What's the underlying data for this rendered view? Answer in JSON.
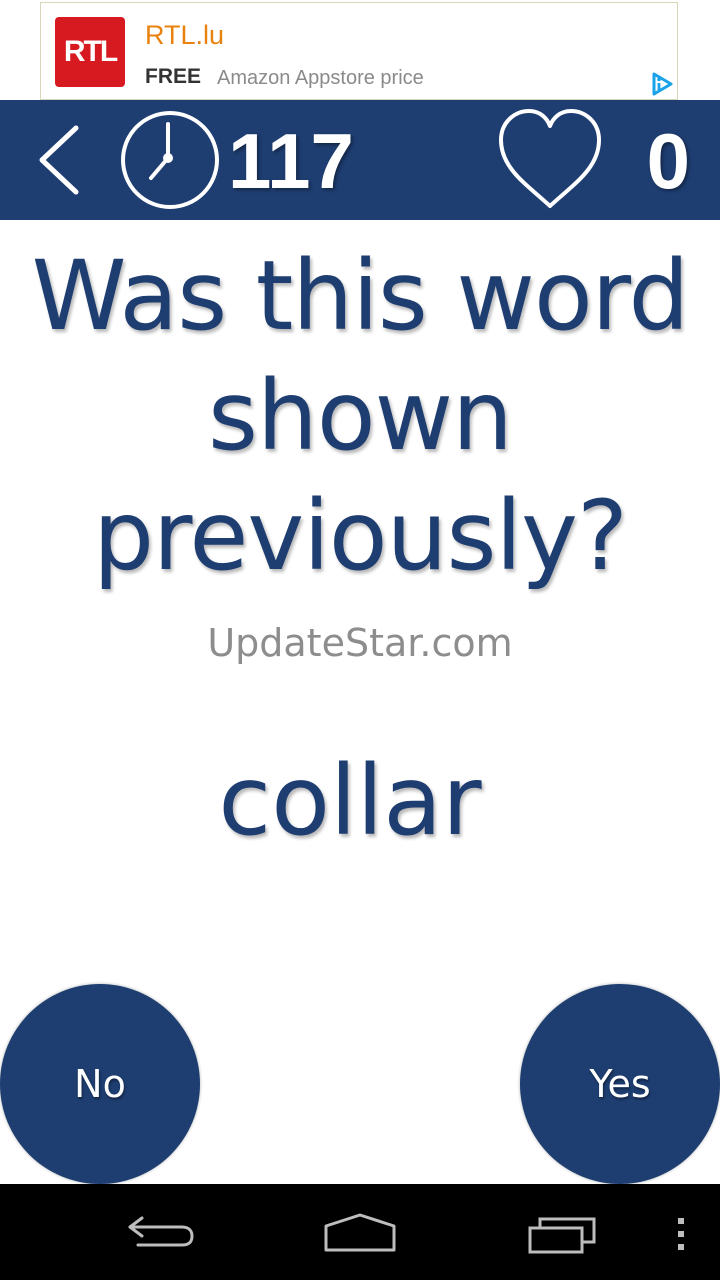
{
  "ad": {
    "logo_text": "RTL",
    "title": "RTL.lu",
    "free_label": "FREE",
    "description": "Amazon Appstore price",
    "colors": {
      "logo_bg": "#d71920",
      "title": "#e8820c",
      "adchoices": "#1aa3e8"
    }
  },
  "header": {
    "back_icon": "chevron-left-icon",
    "timer_icon": "clock-icon",
    "timer_value": "117",
    "lives_icon": "heart-icon",
    "score_value": "0",
    "background_color": "#1e3d70"
  },
  "main": {
    "question_lines": [
      "Was this word",
      "shown",
      "previously?"
    ],
    "watermark": "UpdateStar.com",
    "word": "collar"
  },
  "answers": {
    "no_label": "No",
    "yes_label": "Yes",
    "button_color": "#1e3d70"
  },
  "navbar": {
    "icons": [
      "back-icon",
      "home-icon",
      "recent-apps-icon",
      "overflow-menu-icon"
    ]
  }
}
